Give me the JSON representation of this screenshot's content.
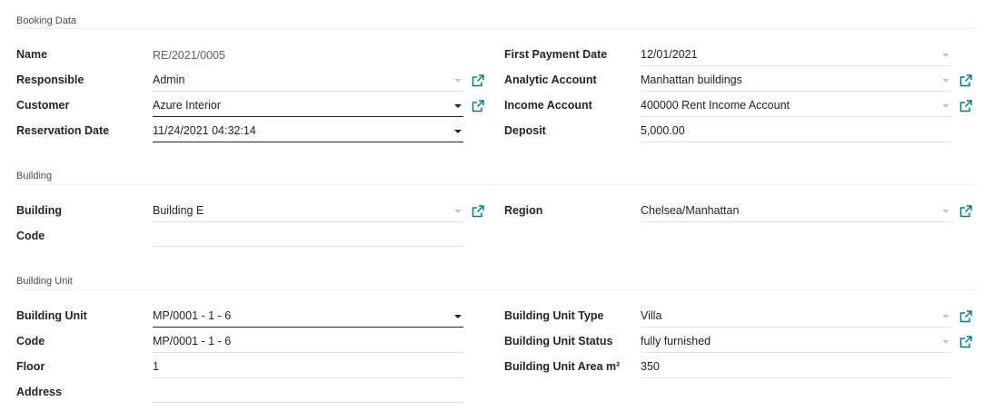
{
  "sections": {
    "booking": {
      "title": "Booking Data",
      "name": {
        "label": "Name",
        "value": "RE/2021/0005"
      },
      "responsible": {
        "label": "Responsible",
        "value": "Admin"
      },
      "customer": {
        "label": "Customer",
        "value": "Azure Interior"
      },
      "reservation_date": {
        "label": "Reservation Date",
        "value": "11/24/2021 04:32:14"
      },
      "first_payment_date": {
        "label": "First Payment Date",
        "value": "12/01/2021"
      },
      "analytic_account": {
        "label": "Analytic Account",
        "value": "Manhattan buildings"
      },
      "income_account": {
        "label": "Income Account",
        "value": "400000 Rent Income Account"
      },
      "deposit": {
        "label": "Deposit",
        "value": "5,000.00"
      }
    },
    "building": {
      "title": "Building",
      "building": {
        "label": "Building",
        "value": "Building E"
      },
      "code": {
        "label": "Code",
        "value": ""
      },
      "region": {
        "label": "Region",
        "value": "Chelsea/Manhattan"
      }
    },
    "unit": {
      "title": "Building Unit",
      "building_unit": {
        "label": "Building Unit",
        "value": "MP/0001 - 1 - 6"
      },
      "code": {
        "label": "Code",
        "value": "MP/0001 - 1 - 6"
      },
      "floor": {
        "label": "Floor",
        "value": "1"
      },
      "address": {
        "label": "Address",
        "value": ""
      },
      "unit_type": {
        "label": "Building Unit Type",
        "value": "Villa"
      },
      "unit_status": {
        "label": "Building Unit Status",
        "value": "fully furnished"
      },
      "unit_area": {
        "label": "Building Unit Area m²",
        "value": "350"
      }
    }
  },
  "colors": {
    "accent": "#017e84",
    "text": "#212529",
    "border": "#dee2e6"
  },
  "icons": {
    "external_link": "external-link-icon",
    "dropdown": "chevron-down-icon"
  }
}
